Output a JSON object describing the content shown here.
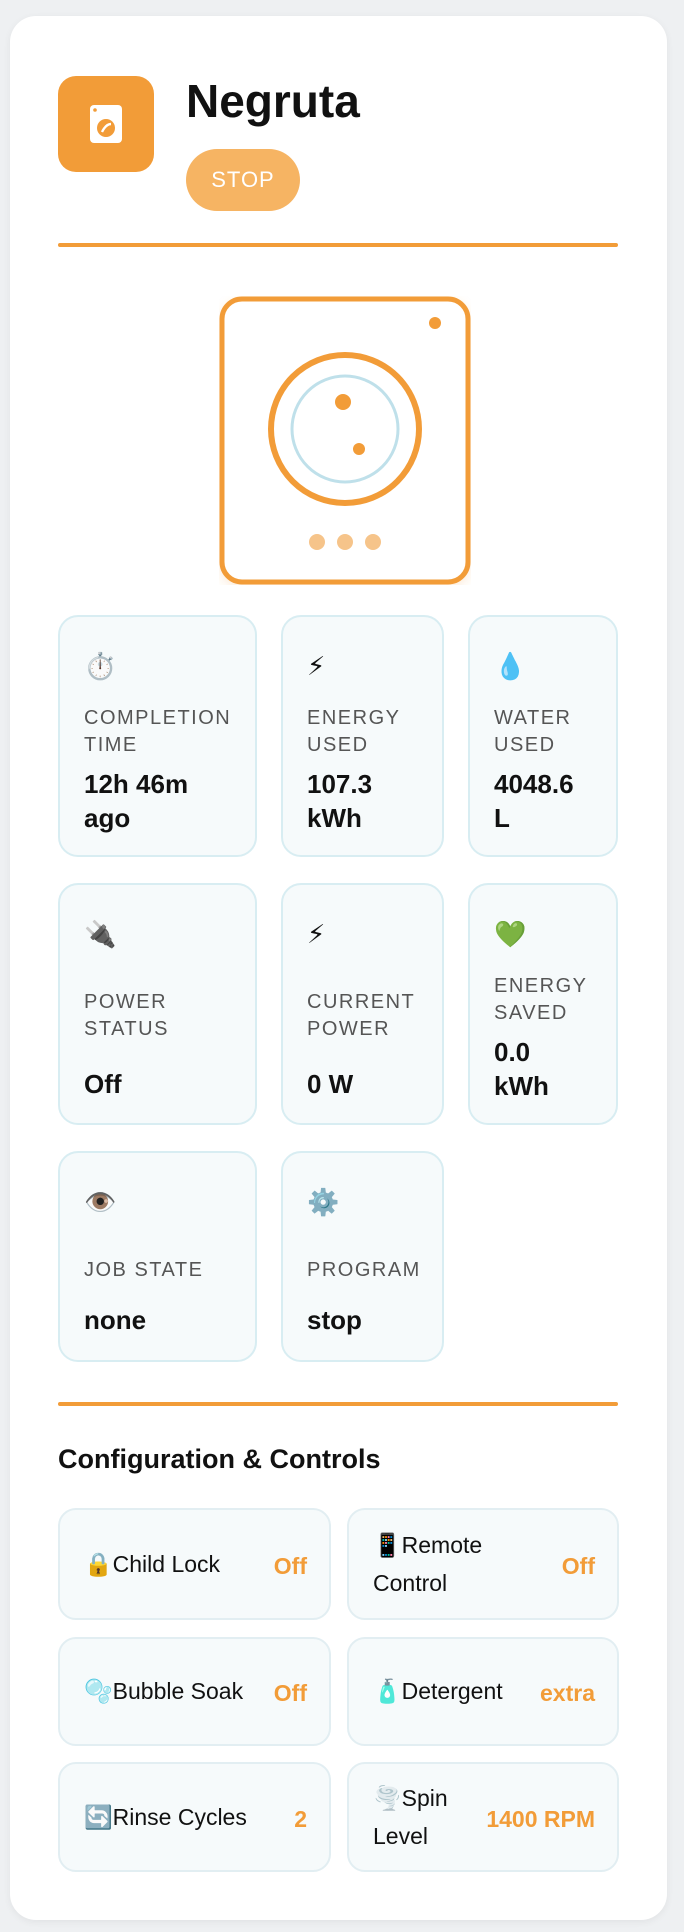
{
  "header": {
    "title": "Negruta",
    "stop_label": "STOP",
    "app_icon": "washing-machine-icon"
  },
  "colors": {
    "accent": "#f29c38",
    "accent_light": "#f6b463",
    "tile_bg": "#f6fafb",
    "tile_border": "#d8edf2"
  },
  "stats": [
    {
      "icon": "⏱️",
      "icon_name": "stopwatch-icon",
      "label_1": "COMPLETION",
      "label_2": "TIME",
      "value_1": "12h 46m",
      "value_2": "ago"
    },
    {
      "icon": "⚡",
      "icon_name": "lightning-icon",
      "label_1": "ENERGY",
      "label_2": "USED",
      "value_1": "107.3",
      "value_2": "kWh"
    },
    {
      "icon": "💧",
      "icon_name": "droplet-icon",
      "label_1": "WATER",
      "label_2": "USED",
      "value_1": "4048.6",
      "value_2": "L"
    },
    {
      "icon": "🔌",
      "icon_name": "plug-icon",
      "label_1": "POWER",
      "label_2": "STATUS",
      "value_1": "Off"
    },
    {
      "icon": "⚡",
      "icon_name": "lightning-icon",
      "label_1": "CURRENT",
      "label_2": "POWER",
      "value_1": "0 W"
    },
    {
      "icon": "💚",
      "icon_name": "green-heart-icon",
      "label_1": "ENERGY",
      "label_2": "SAVED",
      "value_1": "0.0",
      "value_2": "kWh"
    },
    {
      "icon": "👁️",
      "icon_name": "eye-icon",
      "label_1": "JOB STATE",
      "value_1": "none"
    },
    {
      "icon": "⚙️",
      "icon_name": "gear-icon",
      "label_1": "PROGRAM",
      "value_1": "stop"
    }
  ],
  "config": {
    "title": "Configuration & Controls",
    "items": [
      {
        "icon": "🔒",
        "icon_name": "lock-icon",
        "label_1": "Child Lock",
        "value": "Off"
      },
      {
        "icon": "📱",
        "icon_name": "phone-icon",
        "label_1": "Remote",
        "label_2": "Control",
        "value": "Off"
      },
      {
        "icon": "🫧",
        "icon_name": "bubbles-icon",
        "label_1": "Bubble Soak",
        "value": "Off"
      },
      {
        "icon": "🧴",
        "icon_name": "detergent-bottle-icon",
        "label_1": "Detergent",
        "value": "extra"
      },
      {
        "icon": "🔄",
        "icon_name": "rinse-cycle-icon",
        "label_1": "Rinse Cycles",
        "value": "2"
      },
      {
        "icon": "🌪️",
        "icon_name": "spin-tornado-icon",
        "label_1": "Spin",
        "label_2": "Level",
        "value": "1400 RPM"
      }
    ]
  }
}
